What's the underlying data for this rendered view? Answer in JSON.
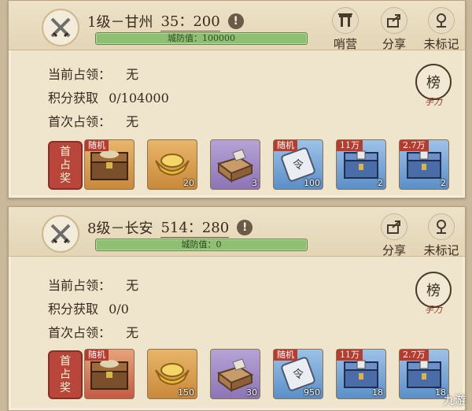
{
  "cards": [
    {
      "title": "1级－甘州",
      "coord": "35：200",
      "info": "!",
      "hp_label": "城防值：100000",
      "buttons": [
        "哨营",
        "分享",
        "未标记"
      ],
      "rows": [
        {
          "label": "当前占领：",
          "value": "无"
        },
        {
          "label": "积分获取",
          "value": "0/104000"
        },
        {
          "label": "首次占领：",
          "value": "无"
        }
      ],
      "rank": {
        "char": "榜",
        "sub": "手力"
      },
      "first_badge": [
        "首",
        "占",
        "奖"
      ],
      "rewards": [
        {
          "kind": "chest",
          "color": "orange",
          "tag": "随机",
          "qty": ""
        },
        {
          "kind": "ingot",
          "color": "orange",
          "tag": "",
          "qty": "20"
        },
        {
          "kind": "pack",
          "color": "purple",
          "tag": "",
          "qty": "3"
        },
        {
          "kind": "scroll",
          "color": "blue",
          "tag": "随机",
          "qty": "100"
        },
        {
          "kind": "box",
          "color": "blue",
          "tag": "11万",
          "qty": "2"
        },
        {
          "kind": "box",
          "color": "blue",
          "tag": "2.7万",
          "qty": "2"
        }
      ]
    },
    {
      "title": "8级－长安",
      "coord": "514：280",
      "info": "!",
      "hp_label": "城防值：0",
      "buttons": [
        "分享",
        "未标记"
      ],
      "rows": [
        {
          "label": "当前占领：",
          "value": "无"
        },
        {
          "label": "积分获取",
          "value": "0/0"
        },
        {
          "label": "首次占领：",
          "value": "无"
        }
      ],
      "rank": {
        "char": "榜",
        "sub": "手力"
      },
      "first_badge": [
        "首",
        "占",
        "奖"
      ],
      "rewards": [
        {
          "kind": "chest",
          "color": "orange-red",
          "tag": "随机",
          "qty": ""
        },
        {
          "kind": "ingot",
          "color": "orange",
          "tag": "",
          "qty": "150"
        },
        {
          "kind": "pack",
          "color": "purple",
          "tag": "",
          "qty": "30"
        },
        {
          "kind": "scroll",
          "color": "blue",
          "tag": "随机",
          "qty": "950"
        },
        {
          "kind": "box",
          "color": "blue",
          "tag": "11万",
          "qty": "18"
        },
        {
          "kind": "box",
          "color": "blue",
          "tag": "2.7万",
          "qty": "18"
        }
      ]
    }
  ],
  "watermark": "九游"
}
